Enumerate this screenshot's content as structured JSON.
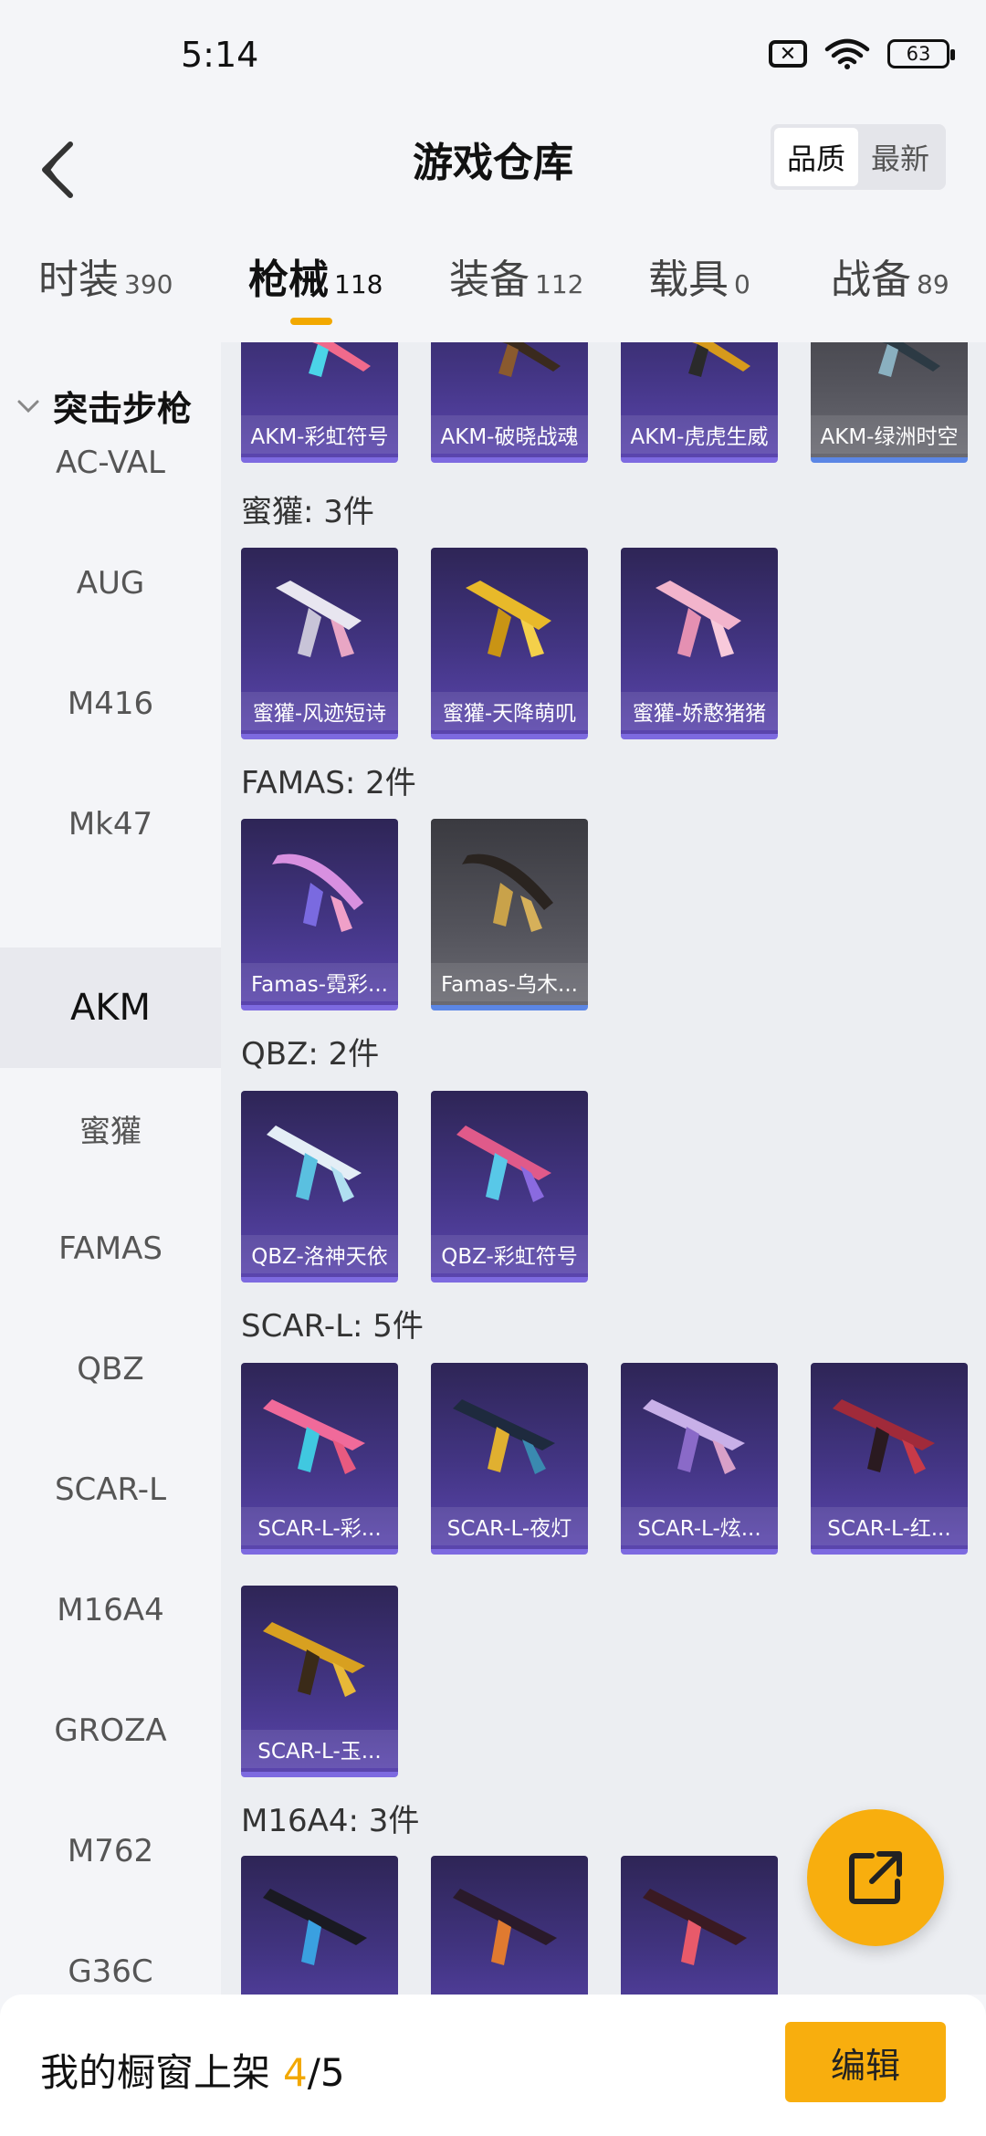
{
  "status_bar": {
    "time": "5:14",
    "battery": "63"
  },
  "header": {
    "title": "游戏仓库",
    "sort_options": [
      "品质",
      "最新"
    ]
  },
  "tabs": [
    {
      "label": "时装",
      "count": "390"
    },
    {
      "label": "枪械",
      "count": "118"
    },
    {
      "label": "装备",
      "count": "112"
    },
    {
      "label": "载具",
      "count": "0"
    },
    {
      "label": "战备",
      "count": "89"
    }
  ],
  "sidebar": {
    "heading": "突击步枪",
    "items": [
      "AC-VAL",
      "AUG",
      "M416",
      "Mk47",
      "AKM",
      "蜜獾",
      "FAMAS",
      "QBZ",
      "SCAR-L",
      "M16A4",
      "GROZA",
      "M762",
      "G36C"
    ],
    "active": "AKM"
  },
  "groups": [
    {
      "label": "",
      "items": [
        "AKM-彩虹符号",
        "AKM-破晓战魂",
        "AKM-虎虎生威",
        "AKM-绿洲时空"
      ]
    },
    {
      "label": "蜜獾: 3件",
      "items": [
        "蜜獾-风迹短诗",
        "蜜獾-天降萌叽",
        "蜜獾-娇憨猪猪"
      ]
    },
    {
      "label": "FAMAS: 2件",
      "items": [
        "Famas-霓彩...",
        "Famas-乌木..."
      ]
    },
    {
      "label": "QBZ: 2件",
      "items": [
        "QBZ-洛神天依",
        "QBZ-彩虹符号"
      ]
    },
    {
      "label": "SCAR-L: 5件",
      "items": [
        "SCAR-L-彩...",
        "SCAR-L-夜灯",
        "SCAR-L-炫...",
        "SCAR-L-红...",
        "SCAR-L-玉..."
      ]
    },
    {
      "label": "M16A4: 3件",
      "items": [
        "",
        "",
        ""
      ]
    }
  ],
  "bottom": {
    "text": "我的橱窗上架",
    "current": "4",
    "separator": "/",
    "total": "5",
    "edit_label": "编辑"
  }
}
